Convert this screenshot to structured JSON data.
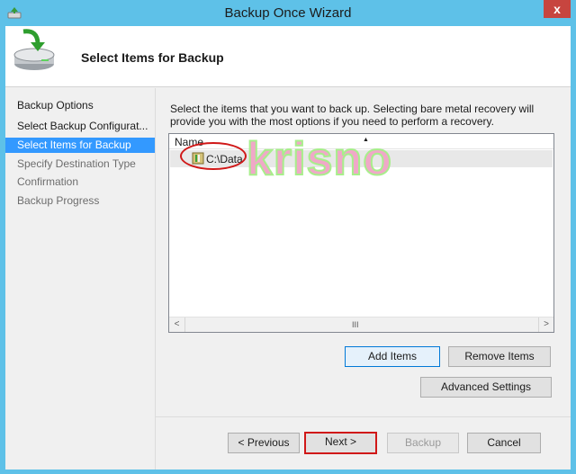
{
  "window": {
    "title": "Backup Once Wizard",
    "close_glyph": "x",
    "app_icon": "backup-wizard-icon"
  },
  "header": {
    "title": "Select Items for Backup",
    "icon": "drive-backup-icon"
  },
  "nav": {
    "items": [
      {
        "label": "Backup Options",
        "state": "normal"
      },
      {
        "label": "Select Backup Configurat...",
        "state": "normal"
      },
      {
        "label": "Select Items for Backup",
        "state": "selected"
      },
      {
        "label": "Specify Destination Type",
        "state": "disabled"
      },
      {
        "label": "Confirmation",
        "state": "disabled"
      },
      {
        "label": "Backup Progress",
        "state": "disabled"
      }
    ]
  },
  "content": {
    "description": "Select the items that you want to back up. Selecting bare metal recovery will provide you with the most options if you need to perform a recovery.",
    "list": {
      "column_header": "Name",
      "sort_glyph": "▲",
      "rows": [
        {
          "label": "C:\\Data",
          "icon": "folder-drive-icon"
        }
      ],
      "scroll_left": "<",
      "scroll_right": ">",
      "scroll_grip": "III"
    },
    "watermark": "krisno",
    "buttons": {
      "add_items": "Add Items",
      "remove_items": "Remove Items",
      "advanced_settings": "Advanced Settings"
    }
  },
  "footer": {
    "previous": "< Previous",
    "next": "Next >",
    "backup": "Backup",
    "cancel": "Cancel"
  },
  "colors": {
    "title_bar": "#5ec1e8",
    "selection": "#3399ff",
    "annotation_red": "#d01818",
    "close_button": "#c7453f"
  }
}
